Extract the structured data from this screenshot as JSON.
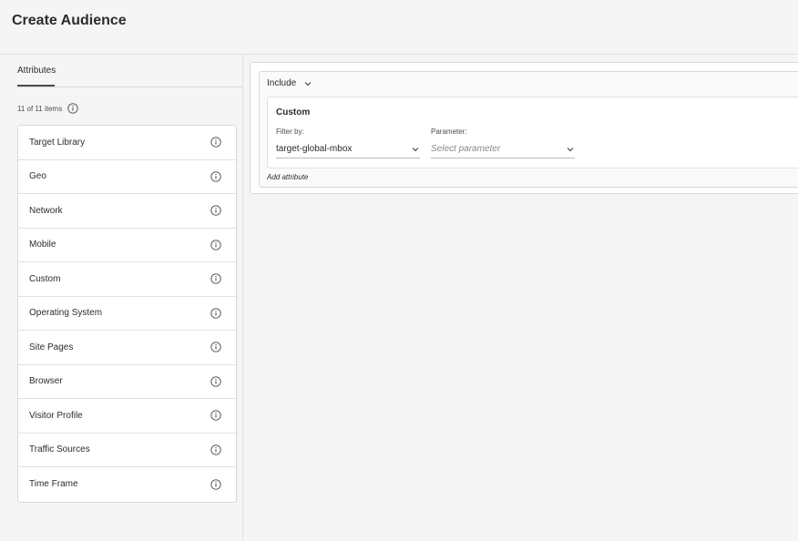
{
  "page": {
    "title": "Create Audience"
  },
  "left_panel": {
    "tab_label": "Attributes",
    "count_text": "11 of 11 items",
    "items": [
      {
        "label": "Target Library"
      },
      {
        "label": "Geo"
      },
      {
        "label": "Network"
      },
      {
        "label": "Mobile"
      },
      {
        "label": "Custom"
      },
      {
        "label": "Operating System"
      },
      {
        "label": "Site Pages"
      },
      {
        "label": "Browser"
      },
      {
        "label": "Visitor Profile"
      },
      {
        "label": "Traffic Sources"
      },
      {
        "label": "Time Frame"
      }
    ]
  },
  "rule_builder": {
    "include_label": "Include",
    "card": {
      "title": "Custom",
      "filter_by_label": "Filter by:",
      "filter_by_value": "target-global-mbox",
      "parameter_label": "Parameter:",
      "parameter_placeholder": "Select parameter"
    },
    "add_attribute_label": "Add attribute"
  },
  "icons": {
    "info": "info-icon",
    "chevron": "chevron-down-icon"
  },
  "colors": {
    "background": "#f5f5f5",
    "card": "#ffffff",
    "border": "#d8d8d8",
    "text": "#2c2c2c",
    "muted": "#8a8a8a"
  }
}
